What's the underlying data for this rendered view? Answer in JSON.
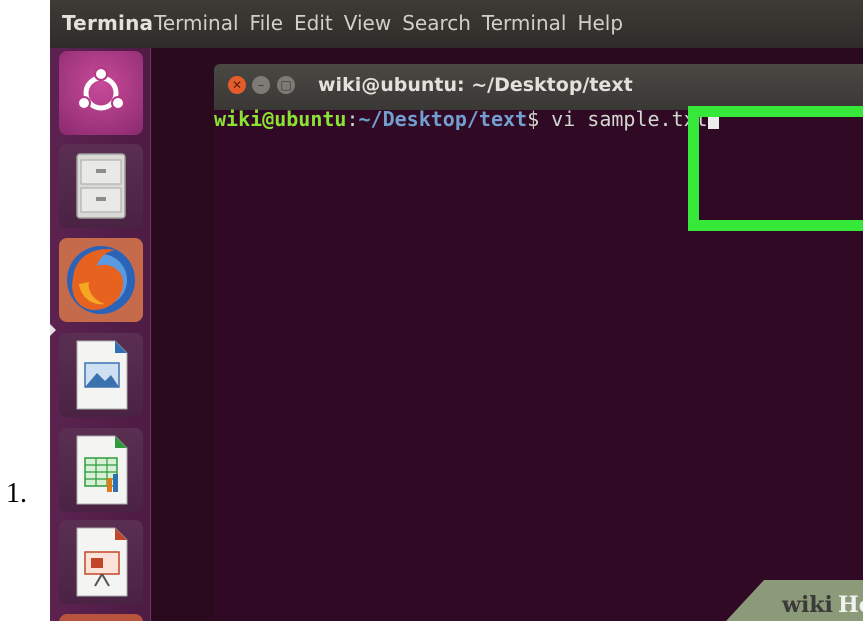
{
  "step_number": "1.",
  "menubar": {
    "app_name": "Termina",
    "items": [
      "Terminal",
      "File",
      "Edit",
      "View",
      "Search",
      "Terminal",
      "Help"
    ]
  },
  "launcher": {
    "icons": [
      "ubuntu-logo-icon",
      "file-cabinet-icon",
      "firefox-icon",
      "libreoffice-writer-icon",
      "libreoffice-calc-icon",
      "libreoffice-impress-icon"
    ]
  },
  "terminal": {
    "title": "wiki@ubuntu: ~/Desktop/text",
    "prompt_user": "wiki@ubuntu",
    "prompt_colon": ":",
    "prompt_path": "~/Desktop/text",
    "prompt_dollar": "$",
    "command": " vi sample.txt"
  },
  "watermark": {
    "wiki": "wiki",
    "how": "How"
  },
  "colors": {
    "terminal_bg": "#300a24",
    "highlight": "#35e839",
    "prompt_user": "#8ae234",
    "prompt_path": "#729fcf"
  }
}
